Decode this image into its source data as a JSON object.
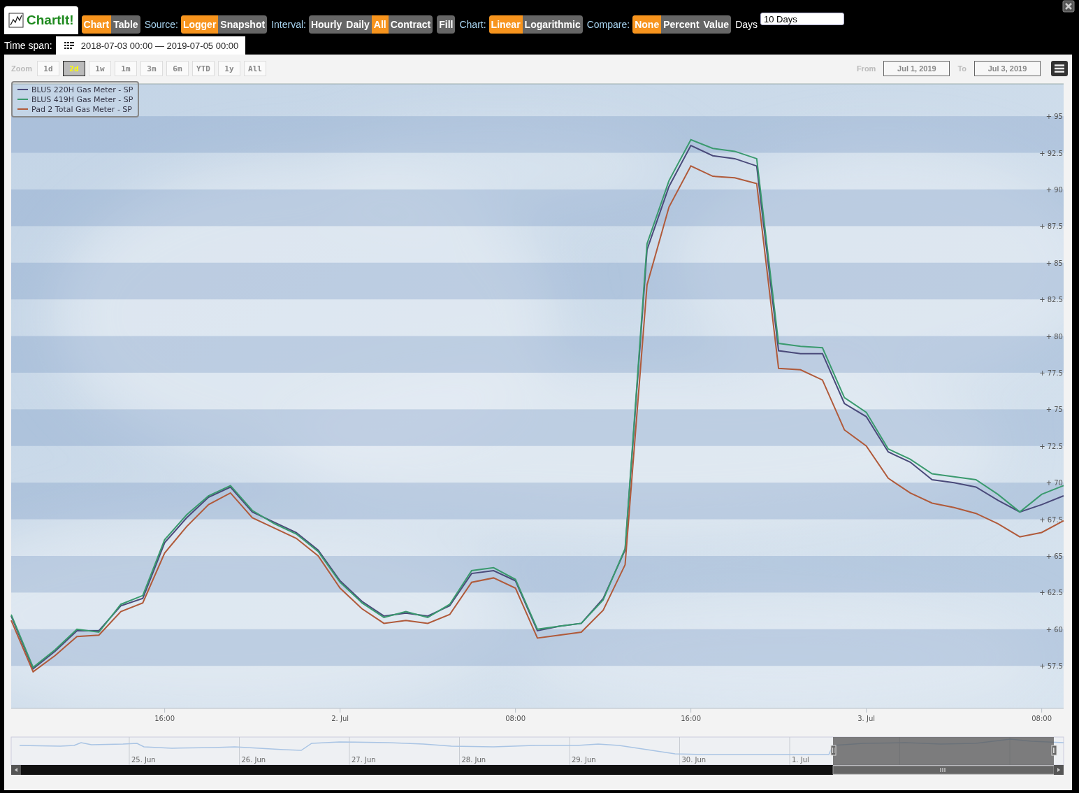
{
  "app": {
    "logo": "ChartIt!"
  },
  "toolbar": [
    {
      "buttons": [
        {
          "label": "Chart",
          "selected": true
        },
        {
          "label": "Table",
          "selected": false
        }
      ]
    },
    {
      "label": "Source:",
      "buttons": [
        {
          "label": "Logger",
          "selected": true
        },
        {
          "label": "Snapshot",
          "selected": false
        }
      ]
    },
    {
      "label": "Interval:",
      "buttons": [
        {
          "label": "Hourly",
          "selected": false
        },
        {
          "label": "Daily",
          "selected": false
        },
        {
          "label": "All",
          "selected": true
        },
        {
          "label": "Contract",
          "selected": false
        }
      ]
    },
    {
      "buttons": [
        {
          "label": "Fill",
          "selected": false
        }
      ]
    },
    {
      "label": "Chart:",
      "buttons": [
        {
          "label": "Linear",
          "selected": true
        },
        {
          "label": "Logarithmic",
          "selected": false
        }
      ]
    },
    {
      "label": "Compare:",
      "buttons": [
        {
          "label": "None",
          "selected": true
        },
        {
          "label": "Percent",
          "selected": false
        },
        {
          "label": "Value",
          "selected": false
        }
      ]
    }
  ],
  "days": {
    "label": "Days",
    "value": "10 Days"
  },
  "time_span": {
    "label": "Time span:",
    "value": "2018-07-03 00:00 — 2019-07-05 00:00"
  },
  "zoom": {
    "label": "Zoom",
    "buttons": [
      {
        "label": "1d",
        "selected": false
      },
      {
        "label": "2d",
        "selected": true
      },
      {
        "label": "1w",
        "selected": false
      },
      {
        "label": "1m",
        "selected": false
      },
      {
        "label": "3m",
        "selected": false
      },
      {
        "label": "6m",
        "selected": false
      },
      {
        "label": "YTD",
        "selected": false
      },
      {
        "label": "1y",
        "selected": false
      },
      {
        "label": "All",
        "selected": false
      }
    ]
  },
  "range": {
    "from_label": "From",
    "from": "Jul 1, 2019",
    "to_label": "To",
    "to": "Jul 3, 2019"
  },
  "chart": {
    "chart_data": {
      "type": "line",
      "categories": [
        null,
        null,
        null,
        null,
        null,
        null,
        null,
        "16:00",
        null,
        null,
        null,
        null,
        null,
        null,
        null,
        "2. Jul",
        null,
        null,
        null,
        null,
        null,
        null,
        null,
        "08:00",
        null,
        null,
        null,
        null,
        null,
        null,
        null,
        "16:00",
        null,
        null,
        null,
        null,
        null,
        null,
        null,
        "3. Jul",
        null,
        null,
        null,
        null,
        null,
        null,
        null,
        "08:00",
        null
      ],
      "ylim": [
        54.6,
        97.2
      ],
      "legend": "upper left",
      "bands": [
        {
          "axis": "y",
          "from": 57.5,
          "to": 60
        },
        {
          "axis": "y",
          "from": 62.5,
          "to": 65
        },
        {
          "axis": "y",
          "from": 67.5,
          "to": 70
        },
        {
          "axis": "y",
          "from": 72.5,
          "to": 75
        },
        {
          "axis": "y",
          "from": 77.5,
          "to": 80
        },
        {
          "axis": "y",
          "from": 82.5,
          "to": 85
        },
        {
          "axis": "y",
          "from": 87.5,
          "to": 90
        },
        {
          "axis": "y",
          "from": 92.5,
          "to": 95
        }
      ],
      "yticks": [
        {
          "value": 57.5,
          "label": "+ 57.5"
        },
        {
          "value": 60,
          "label": "+ 60"
        },
        {
          "value": 62.5,
          "label": "+ 62.5"
        },
        {
          "value": 65,
          "label": "+ 65"
        },
        {
          "value": 67.5,
          "label": "+ 67.5"
        },
        {
          "value": 70,
          "label": "+ 70"
        },
        {
          "value": 72.5,
          "label": "+ 72.5"
        },
        {
          "value": 75,
          "label": "+ 75"
        },
        {
          "value": 77.5,
          "label": "+ 77.5"
        },
        {
          "value": 80,
          "label": "+ 80"
        },
        {
          "value": 82.5,
          "label": "+ 82.5"
        },
        {
          "value": 85,
          "label": "+ 85"
        },
        {
          "value": 87.5,
          "label": "+ 87.5"
        },
        {
          "value": 90,
          "label": "+ 90"
        },
        {
          "value": 92.5,
          "label": "+ 92.5"
        },
        {
          "value": 95,
          "label": "+ 95"
        }
      ],
      "series": [
        {
          "name": "BLUS 220H Gas Meter - SP",
          "color": "#4a4a7a",
          "values": [
            60.9,
            57.3,
            58.5,
            59.9,
            59.9,
            61.6,
            62.1,
            65.9,
            67.6,
            69.0,
            69.7,
            68.0,
            67.3,
            66.6,
            65.4,
            63.3,
            61.9,
            60.9,
            61.1,
            60.9,
            61.6,
            63.8,
            64.0,
            63.3,
            59.9,
            60.2,
            60.4,
            62.1,
            65.4,
            85.9,
            90.2,
            93.0,
            92.3,
            92.1,
            91.6,
            79.0,
            78.8,
            78.8,
            75.4,
            74.5,
            72.1,
            71.4,
            70.2,
            70.0,
            69.7,
            68.8,
            68.0,
            68.5,
            69.1
          ]
        },
        {
          "name": "BLUS 419H Gas Meter - SP",
          "color": "#3a9a6e",
          "values": [
            61.0,
            57.4,
            58.6,
            60.0,
            59.8,
            61.7,
            62.3,
            66.1,
            67.8,
            69.1,
            69.8,
            68.1,
            67.2,
            66.5,
            65.3,
            63.2,
            61.8,
            60.8,
            61.2,
            60.8,
            61.7,
            64.0,
            64.2,
            63.4,
            60.0,
            60.2,
            60.4,
            62.0,
            65.5,
            86.3,
            90.6,
            93.4,
            92.8,
            92.6,
            92.1,
            79.5,
            79.3,
            79.2,
            75.8,
            74.8,
            72.3,
            71.6,
            70.6,
            70.4,
            70.2,
            69.2,
            68.0,
            69.2,
            69.8
          ]
        },
        {
          "name": "Pad 2 Total Gas Meter - SP",
          "color": "#b05a3a",
          "values": [
            60.6,
            57.1,
            58.2,
            59.5,
            59.6,
            61.2,
            61.8,
            65.2,
            67.0,
            68.5,
            69.3,
            67.6,
            66.9,
            66.2,
            65.0,
            62.8,
            61.4,
            60.4,
            60.6,
            60.4,
            61.0,
            63.2,
            63.5,
            62.8,
            59.4,
            59.6,
            59.8,
            61.3,
            64.4,
            83.5,
            88.8,
            91.6,
            90.9,
            90.8,
            90.4,
            77.8,
            77.7,
            77.0,
            73.6,
            72.5,
            70.3,
            69.3,
            68.6,
            68.3,
            67.9,
            67.2,
            66.3,
            66.6,
            67.4
          ]
        }
      ]
    }
  },
  "navigator": {
    "labels": [
      "25. Jun",
      "26. Jun",
      "27. Jun",
      "28. Jun",
      "29. Jun",
      "30. Jun",
      "1. Jul"
    ]
  }
}
